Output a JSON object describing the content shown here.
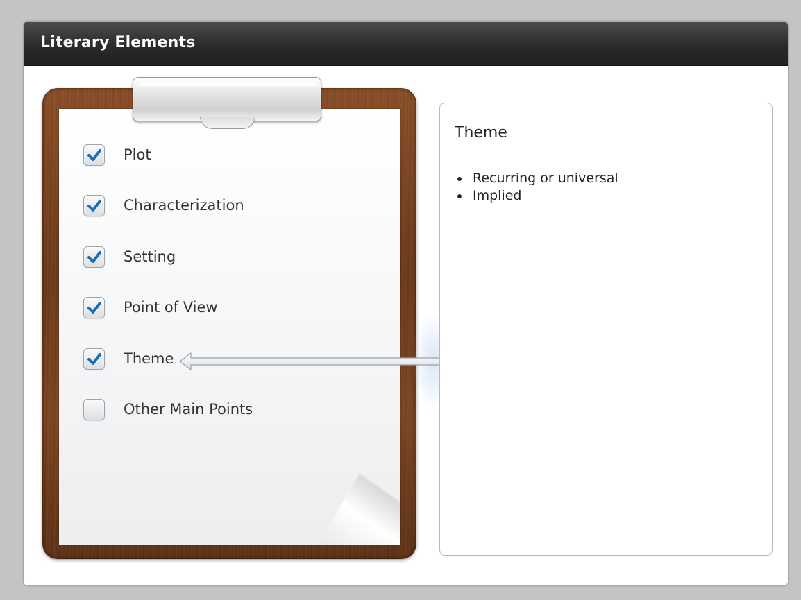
{
  "window": {
    "title": "Literary Elements"
  },
  "checklist": {
    "items": [
      {
        "label": "Plot",
        "checked": true
      },
      {
        "label": "Characterization",
        "checked": true
      },
      {
        "label": "Setting",
        "checked": true
      },
      {
        "label": "Point of View",
        "checked": true
      },
      {
        "label": "Theme",
        "checked": true,
        "selected": true
      },
      {
        "label": "Other Main Points",
        "checked": false
      }
    ]
  },
  "detail": {
    "title": "Theme",
    "bullets": [
      "Recurring or universal",
      "Implied"
    ]
  },
  "colors": {
    "titlebar": "#2b2b2b",
    "checkmark": "#1b6fb5",
    "clipboard_wood": "#7d4520",
    "page_background": "#c4c4c4"
  },
  "icons": {
    "check": "checkmark-icon",
    "arrow": "left-arrow-icon",
    "clip": "clipboard-clip"
  }
}
